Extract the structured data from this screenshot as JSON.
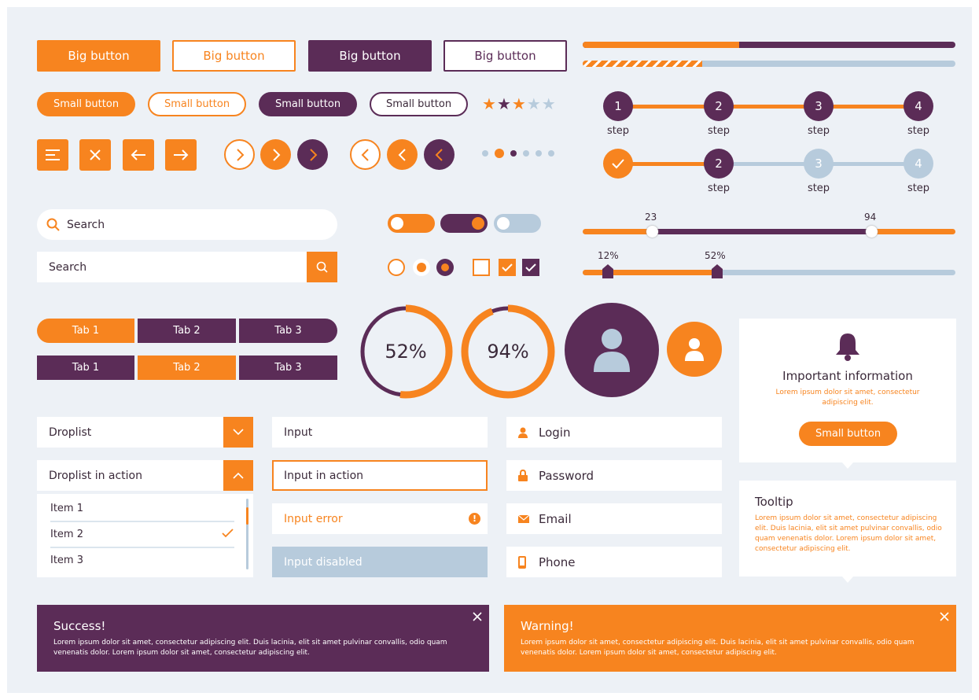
{
  "colors": {
    "orange": "#f7841f",
    "purple": "#5b2c57",
    "light": "#b7cbdc",
    "bg": "#edf1f6"
  },
  "big_buttons": [
    "Big button",
    "Big button",
    "Big button",
    "Big button"
  ],
  "small_buttons": [
    "Small button",
    "Small button",
    "Small button",
    "Small button"
  ],
  "rating": {
    "filled_orange": 1,
    "filled_purple": 1,
    "filled_orange2": 1,
    "empty": 2,
    "value": 3,
    "max": 5
  },
  "progress": {
    "solid": 0.42,
    "striped": 0.32
  },
  "stepper_top": {
    "numbers": [
      "1",
      "2",
      "3",
      "4"
    ],
    "labels": [
      "step",
      "step",
      "step",
      "step"
    ]
  },
  "stepper_bottom": {
    "numbers": [
      "",
      "2",
      "3",
      "4"
    ],
    "labels": [
      "step",
      "step",
      "step"
    ]
  },
  "search1": {
    "placeholder": "Search"
  },
  "search2": {
    "placeholder": "Search"
  },
  "range_slider": {
    "low": "23",
    "high": "94"
  },
  "marker_slider": {
    "a": "12%",
    "b": "52%"
  },
  "tabs_a": [
    "Tab 1",
    "Tab 2",
    "Tab 3"
  ],
  "tabs_b": [
    "Tab 1",
    "Tab 2",
    "Tab 3"
  ],
  "rings": {
    "first": "52%",
    "second": "94%",
    "first_value": 52,
    "second_value": 94
  },
  "notification": {
    "title": "Important information",
    "body": "Lorem ipsum dolor sit amet, consectetur adipiscing elit.",
    "button": "Small button"
  },
  "tooltip": {
    "title": "Tooltip",
    "body": "Lorem ipsum dolor sit amet, consectetur adipiscing elit. Duis lacinia, elit sit amet pulvinar convallis, odio quam venenatis dolor. Lorem ipsum dolor sit amet, consectetur adipiscing elit."
  },
  "droplist": {
    "label": "Droplist",
    "active_label": "Droplist in action",
    "items": [
      "Item 1",
      "Item 2",
      "Item 3"
    ]
  },
  "inputs": {
    "normal": "Input",
    "active": "Input in action",
    "error": "Input error",
    "disabled": "Input disabled"
  },
  "icon_fields": {
    "login": "Login",
    "password": "Password",
    "email": "Email",
    "phone": "Phone"
  },
  "alerts": {
    "success_title": "Success!",
    "success_body": "Lorem ipsum dolor sit amet, consectetur adipiscing elit. Duis lacinia, elit sit amet pulvinar convallis, odio quam venenatis dolor. Lorem ipsum dolor sit amet, consectetur adipiscing elit.",
    "warning_title": "Warning!",
    "warning_body": "Lorem ipsum dolor sit amet, consectetur adipiscing elit. Duis lacinia, elit sit amet pulvinar convallis, odio quam venenatis dolor. Lorem ipsum dolor sit amet, consectetur adipiscing elit."
  }
}
